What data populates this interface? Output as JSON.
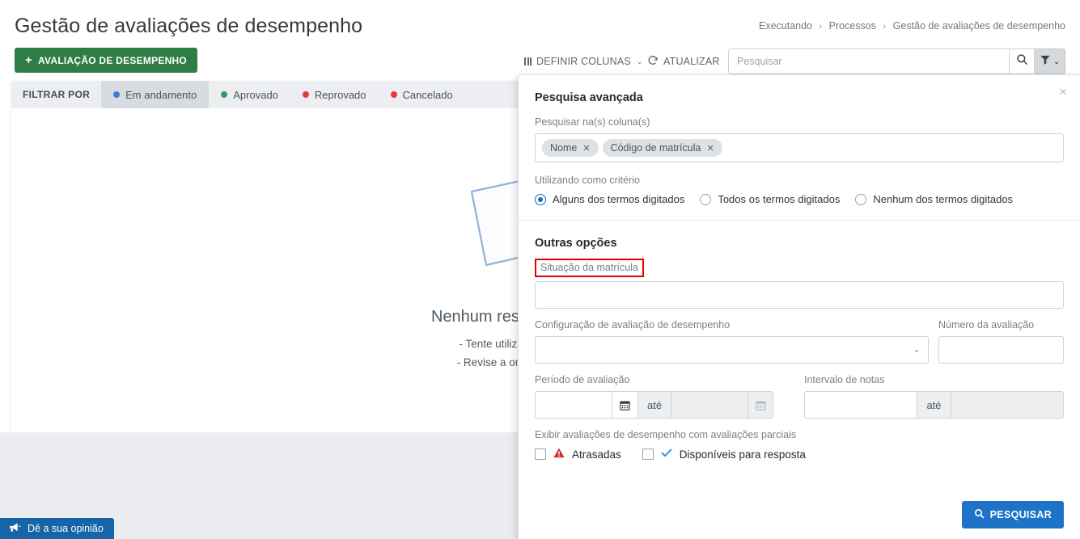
{
  "header": {
    "title": "Gestão de avaliações de desempenho",
    "breadcrumb": [
      "Executando",
      "Processos",
      "Gestão de avaliações de desempenho"
    ],
    "breadcrumb_separator": "›"
  },
  "actions": {
    "new_evaluation_label": "AVALIAÇÃO DE DESEMPENHO",
    "new_evaluation_plus": "+"
  },
  "toolbar": {
    "define_columns_label": "DEFINIR COLUNAS",
    "define_columns_caret": "⌄",
    "refresh_label": "ATUALIZAR",
    "search_placeholder": "Pesquisar",
    "search_value": "",
    "filter_caret": "⌄"
  },
  "filter_bar": {
    "label": "FILTRAR POR",
    "chips": [
      {
        "label": "Em andamento",
        "color": "#3b7dd8",
        "active": true
      },
      {
        "label": "Aprovado",
        "color": "#2e9e5b",
        "active": false
      },
      {
        "label": "Reprovado",
        "color": "#e03b3b",
        "active": false
      },
      {
        "label": "Cancelado",
        "color": "#e03b3b",
        "active": false
      }
    ]
  },
  "empty_state": {
    "title": "Nenhum resultado encontrado",
    "hint_line1": "- Tente utilizar uma outra palavra.",
    "hint_line2": "- Revise a ortografia das palavras."
  },
  "advanced_search": {
    "title": "Pesquisa avançada",
    "close_label": "×",
    "columns_label": "Pesquisar na(s) coluna(s)",
    "column_chips": [
      {
        "label": "Nome",
        "remove": "✕"
      },
      {
        "label": "Código de matrícula",
        "remove": "✕"
      }
    ],
    "criteria_label": "Utilizando como critério",
    "criteria_options": [
      {
        "label": "Alguns dos termos digitados",
        "selected": true
      },
      {
        "label": "Todos os termos digitados",
        "selected": false
      },
      {
        "label": "Nenhum dos termos digitados",
        "selected": false
      }
    ],
    "other_options_title": "Outras opções",
    "situacao_label": "Situação da matrícula",
    "situacao_value": "",
    "situacao_highlight_color": "#e60000",
    "config_label": "Configuração de avaliação de desempenho",
    "config_value": "",
    "config_caret": "⌄",
    "numero_label": "Número da avaliação",
    "numero_value": "",
    "periodo_label": "Período de avaliação",
    "periodo_start": "",
    "periodo_end": "",
    "periodo_until": "até",
    "intervalo_label": "Intervalo de notas",
    "intervalo_start": "",
    "intervalo_end": "",
    "intervalo_until": "até",
    "partials_label": "Exibir avaliações de desempenho com avaliações parciais",
    "checkboxes": [
      {
        "label": "Atrasadas",
        "icon": "warning-triangle-icon",
        "icon_color": "#d32f2f",
        "checked": false
      },
      {
        "label": "Disponíveis para resposta",
        "icon": "check-icon",
        "icon_color": "#2a8fd6",
        "checked": false
      }
    ],
    "submit_label": "PESQUISAR"
  },
  "feedback": {
    "label": "Dê a sua opinião"
  },
  "colors": {
    "green": "#2e7d45",
    "blue": "#1d73c8",
    "panel_border": "#dcdfe3",
    "page_gray": "#eaecef"
  }
}
